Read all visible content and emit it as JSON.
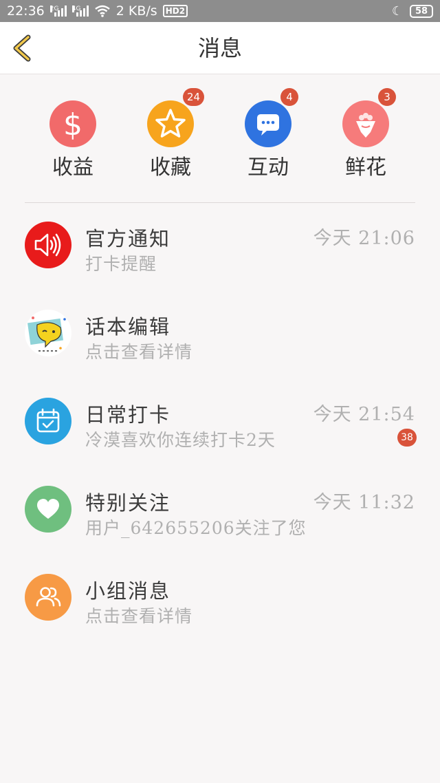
{
  "status": {
    "time": "22:36",
    "net_2g": "2G",
    "net_4g": "4G",
    "speed": "2 KB/s",
    "hd": "HD2",
    "battery": "58"
  },
  "header": {
    "title": "消息",
    "back_icon": "chevron-left-icon",
    "back_color": "#f2c94c"
  },
  "quick_actions": [
    {
      "label": "收益",
      "icon": "dollar-icon",
      "color": "#f16a6a",
      "badge": ""
    },
    {
      "label": "收藏",
      "icon": "star-icon",
      "color": "#f7a41d",
      "badge": "24"
    },
    {
      "label": "互动",
      "icon": "chat-bubble-icon",
      "color": "#2f73e0",
      "badge": "4"
    },
    {
      "label": "鲜花",
      "icon": "flower-bouquet-icon",
      "color": "#f67b7b",
      "badge": "3"
    }
  ],
  "messages": [
    {
      "title": "官方通知",
      "subtitle": "打卡提醒",
      "time": "今天 21:06",
      "badge": "",
      "icon": "speaker-icon",
      "color": "#e81b1b"
    },
    {
      "title": "话本编辑",
      "subtitle": "点击查看详情",
      "time": "",
      "badge": "",
      "icon": "editor-avatar-icon",
      "color": "#ffffff"
    },
    {
      "title": "日常打卡",
      "subtitle": "冷漠喜欢你连续打卡2天",
      "time": "今天 21:54",
      "badge": "38",
      "icon": "calendar-check-icon",
      "color": "#2aa3e0"
    },
    {
      "title": "特别关注",
      "subtitle": "用户_642655206关注了您",
      "time": "今天 11:32",
      "badge": "",
      "icon": "heart-icon",
      "color": "#6fbf7f"
    },
    {
      "title": "小组消息",
      "subtitle": "点击查看详情",
      "time": "",
      "badge": "",
      "icon": "group-icon",
      "color": "#f79a45"
    }
  ],
  "badge_color": "#d9533a"
}
